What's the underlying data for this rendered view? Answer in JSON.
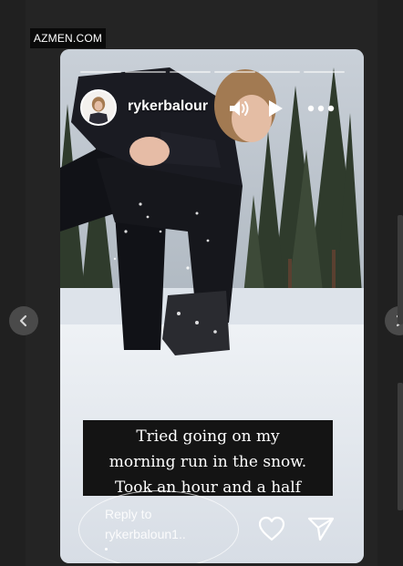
{
  "watermark": {
    "text": "AZMEN.COM"
  },
  "story": {
    "username": "rykerbalour",
    "progress_segments": 6,
    "caption": [
      "Tried going on my",
      "morning run in the snow.",
      "Took an hour and a half"
    ],
    "reply": {
      "line1": "Reply to",
      "line2": "rykerbaloun1.."
    }
  },
  "icons": {
    "mute": "speaker-icon",
    "play": "play-icon",
    "more": "more-icon",
    "like": "heart-icon",
    "share": "send-icon",
    "prev": "chevron-left-icon",
    "next": "chevron-right-icon"
  },
  "colors": {
    "background": "#242424",
    "snow": "#e6ebf1",
    "caption_bg": "#141414"
  }
}
